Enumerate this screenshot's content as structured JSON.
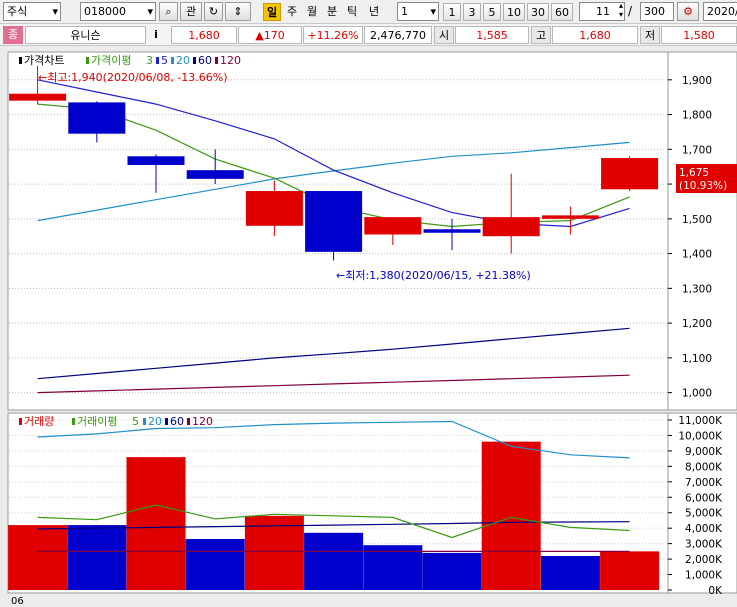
{
  "toolbar": {
    "market_type": "주식",
    "stock_code": "018000",
    "btn_search": "⌕",
    "btn_view": "관",
    "btn_refresh": "↻",
    "btn_updown": "⇕",
    "periods": [
      "일",
      "주",
      "월",
      "분",
      "틱",
      "년"
    ],
    "active_period": "일",
    "interval_value": "1",
    "interval_buttons": [
      "1",
      "3",
      "5",
      "10",
      "30",
      "60"
    ],
    "count_value": "11",
    "count_sep": "/",
    "total_value": "300",
    "date_value": "2020/"
  },
  "quote": {
    "badge": "종",
    "stock_name": "유니슨",
    "info_btn": "i",
    "price": "1,680",
    "change": "▲170",
    "change_pct": "+11.26%",
    "volume": "2,476,770",
    "open_label": "시",
    "open": "1,585",
    "high_label": "고",
    "high": "1,680",
    "low_label": "저",
    "low": "1,580"
  },
  "colors": {
    "up": "#e00000",
    "down": "#0000cc",
    "ma3": "#3a9a10",
    "ma5": "#2020d0",
    "ma20": "#2090c8",
    "ma60": "#000080",
    "ma120": "#800040"
  },
  "chart_data": [
    {
      "type": "candlestick",
      "legend": {
        "title": "가격차트",
        "ma_label": "가격이평",
        "periods": [
          "3",
          "5",
          "20",
          "60",
          "120"
        ]
      },
      "ylim": [
        950,
        1980
      ],
      "y_ticks": [
        1000,
        1100,
        1200,
        1300,
        1400,
        1500,
        1600,
        1700,
        1800,
        1900
      ],
      "y_tick_labels": [
        "1,000",
        "1,100",
        "1,200",
        "1,300",
        "1,400",
        "1,500",
        "1,600",
        "1,700",
        "1,800",
        "1,900"
      ],
      "current_price_label": "1,675",
      "current_pct_label": "(10.93%)",
      "annotations": {
        "high": "←최고:1,940(2020/06/08, -13.66%)",
        "low": "←최저:1,380(2020/06/15, +21.38%)"
      },
      "candles": [
        {
          "o": 1840,
          "h": 1940,
          "l": 1830,
          "c": 1860
        },
        {
          "o": 1835,
          "h": 1838,
          "l": 1720,
          "c": 1745
        },
        {
          "o": 1680,
          "h": 1685,
          "l": 1575,
          "c": 1655
        },
        {
          "o": 1640,
          "h": 1700,
          "l": 1600,
          "c": 1615
        },
        {
          "o": 1480,
          "h": 1610,
          "l": 1450,
          "c": 1580
        },
        {
          "o": 1580,
          "h": 1580,
          "l": 1380,
          "c": 1405
        },
        {
          "o": 1455,
          "h": 1505,
          "l": 1425,
          "c": 1505
        },
        {
          "o": 1470,
          "h": 1500,
          "l": 1410,
          "c": 1460
        },
        {
          "o": 1450,
          "h": 1630,
          "l": 1400,
          "c": 1505
        },
        {
          "o": 1500,
          "h": 1535,
          "l": 1455,
          "c": 1510
        },
        {
          "o": 1585,
          "h": 1680,
          "l": 1580,
          "c": 1675
        }
      ],
      "series": [
        {
          "name": "3",
          "values": [
            1830,
            1815,
            1755,
            1672,
            1617,
            1535,
            1497,
            1478,
            1490,
            1495,
            1563
          ]
        },
        {
          "name": "5",
          "values": [
            1900,
            1865,
            1830,
            1782,
            1730,
            1640,
            1575,
            1518,
            1487,
            1478,
            1530
          ]
        },
        {
          "name": "20",
          "values": [
            1495,
            1525,
            1555,
            1585,
            1615,
            1638,
            1660,
            1680,
            1690,
            1705,
            1720
          ]
        },
        {
          "name": "60",
          "values": [
            1040,
            1055,
            1070,
            1085,
            1100,
            1112,
            1125,
            1140,
            1155,
            1170,
            1185
          ]
        },
        {
          "name": "120",
          "values": [
            1000,
            1005,
            1010,
            1015,
            1020,
            1025,
            1030,
            1035,
            1040,
            1045,
            1050
          ]
        }
      ]
    },
    {
      "type": "bar",
      "legend": {
        "title": "거래량",
        "ma_label": "거래이평",
        "periods": [
          "5",
          "20",
          "60",
          "120"
        ]
      },
      "ylim": [
        0,
        11000
      ],
      "y_ticks": [
        0,
        1000,
        2000,
        3000,
        4000,
        5000,
        6000,
        7000,
        8000,
        9000,
        10000,
        11000
      ],
      "y_tick_labels": [
        "0K",
        "1,000K",
        "2,000K",
        "3,000K",
        "4,000K",
        "5,000K",
        "6,000K",
        "7,000K",
        "8,000K",
        "9,000K",
        "10,000K",
        "11,000K"
      ],
      "x_label": "06",
      "volumes": [
        {
          "v": 4200,
          "up": true
        },
        {
          "v": 4200,
          "up": false
        },
        {
          "v": 8600,
          "up": true
        },
        {
          "v": 3300,
          "up": false
        },
        {
          "v": 4800,
          "up": true
        },
        {
          "v": 3700,
          "up": false
        },
        {
          "v": 2900,
          "up": false
        },
        {
          "v": 2400,
          "up": false
        },
        {
          "v": 9600,
          "up": true
        },
        {
          "v": 2200,
          "up": false
        },
        {
          "v": 2500,
          "up": true
        }
      ],
      "series": [
        {
          "name": "5",
          "values": [
            4700,
            4550,
            5500,
            4600,
            4900,
            4800,
            4700,
            3400,
            4700,
            4050,
            3850
          ]
        },
        {
          "name": "20",
          "values": [
            9900,
            10100,
            10450,
            10500,
            10700,
            10800,
            10850,
            10900,
            9300,
            8750,
            8550
          ]
        },
        {
          "name": "60",
          "values": [
            3950,
            4000,
            4050,
            4100,
            4150,
            4200,
            4250,
            4300,
            4380,
            4400,
            4420
          ]
        },
        {
          "name": "120",
          "values": [
            2500,
            2500,
            2500,
            2500,
            2500,
            2500,
            2500,
            2500,
            2500,
            2500,
            2500
          ]
        }
      ]
    }
  ]
}
